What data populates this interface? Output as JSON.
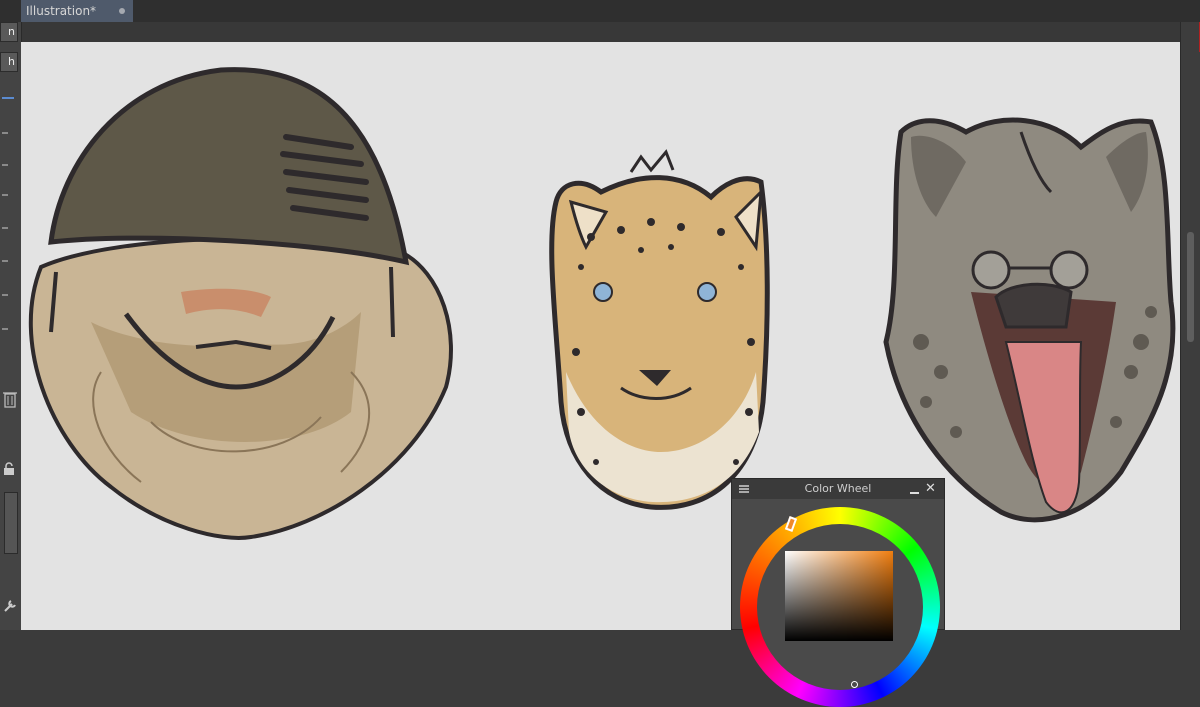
{
  "document_tab": {
    "title": "Illustration*"
  },
  "left_panel": {
    "buttons": [
      "n",
      "h"
    ]
  },
  "color_wheel": {
    "title": "Color Wheel",
    "close_glyph": "✕",
    "selected_color": "#f08a2a"
  },
  "palette": {
    "helmet": "#5e5848",
    "outline": "#2e2a2c",
    "lion_fur": "#c9b595",
    "cheetah_fur": "#d8b47a",
    "hyena_fur": "#8f8a80",
    "tongue": "#d98686",
    "canvas_bg": "#e3e3e3"
  }
}
